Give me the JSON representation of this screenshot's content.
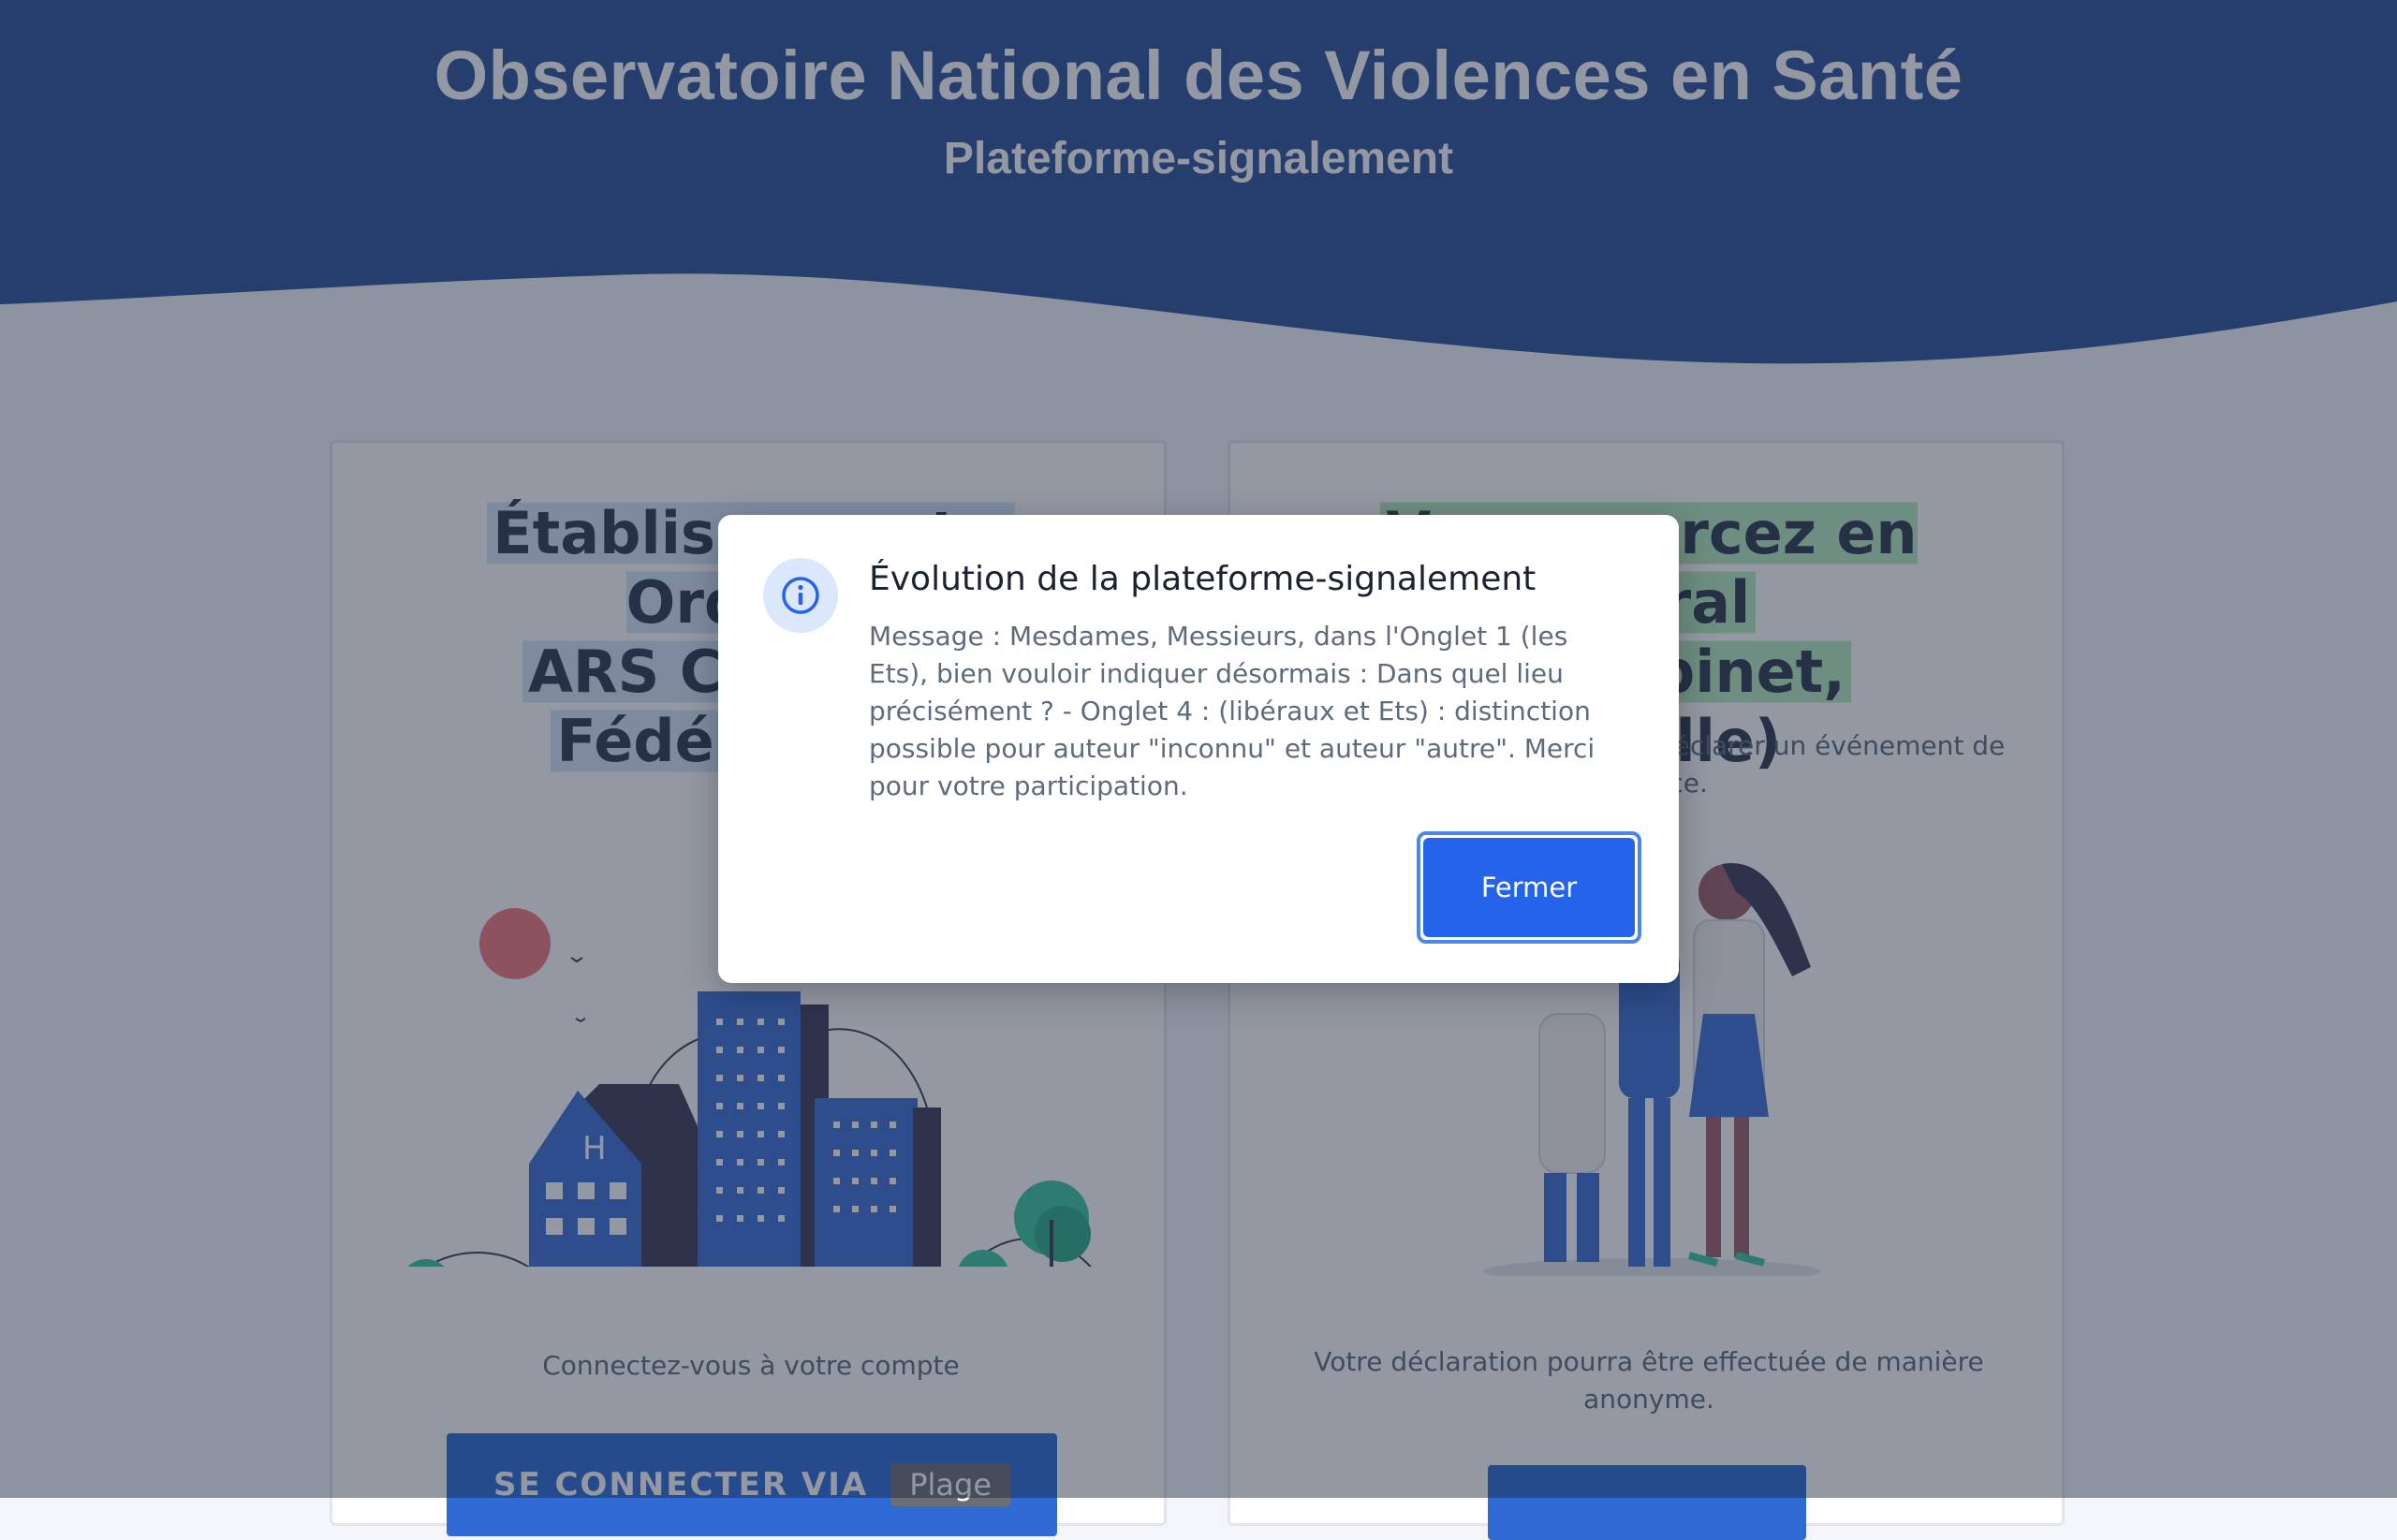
{
  "header": {
    "title": "Observatoire National des Violences en Santé",
    "subtitle": "Plateforme-signalement"
  },
  "cards": {
    "left": {
      "title_line1": "Établissements, Ordres,",
      "title_line2": "ARS Conseils,",
      "title_line3": "Fédérations",
      "description": "Connectez-vous à votre compte",
      "button_label": "SE CONNECTER VIA",
      "button_logo": "Plage",
      "illustration_letter": "H"
    },
    "right": {
      "title_line1": "Vous exercez en libéral",
      "title_line2": "(en cabinet,",
      "title_line3": "de ville)",
      "subtext": "Pas besoin de compte pour déclarer un événement de violence.",
      "description": "Votre déclaration pourra être effectuée de manière anonyme."
    }
  },
  "modal": {
    "icon": "info-icon",
    "title": "Évolution de la plateforme-signalement",
    "message": "Message : Mesdames, Messieurs, dans l'Onglet 1 (les Ets), bien vouloir indiquer désormais : Dans quel lieu précisément ? - Onglet 4 : (libéraux et Ets) : distinction possible pour auteur \"inconnu\" et auteur \"autre\". Merci pour votre participation.",
    "close_label": "Fermer"
  },
  "colors": {
    "header_blue": "#2f5497",
    "primary_button": "#2563eb",
    "overlay": "rgba(30,40,62,0.48)"
  }
}
